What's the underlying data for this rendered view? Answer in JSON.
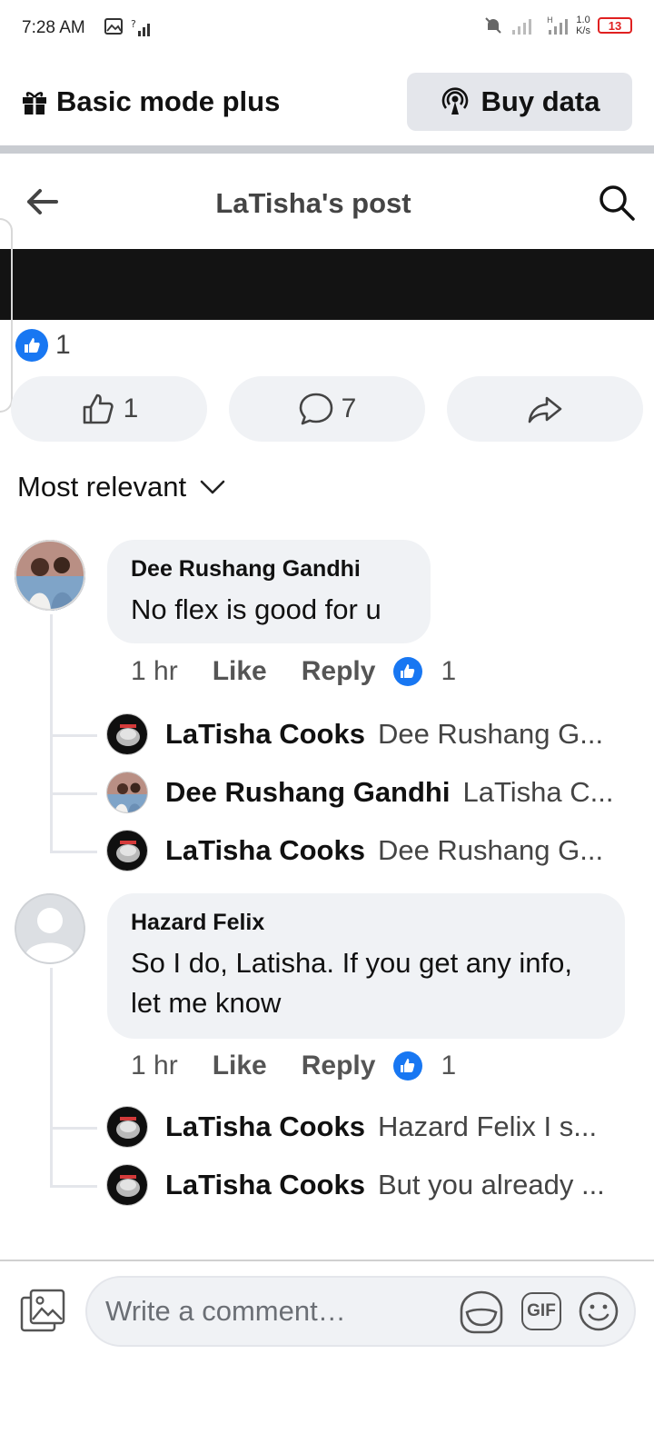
{
  "status_bar": {
    "time": "7:28 AM",
    "network_speed_value": "1.0",
    "network_speed_unit": "K/s",
    "battery_level": "13"
  },
  "mode_bar": {
    "title": "Basic mode plus",
    "buy_data_label": "Buy data"
  },
  "header": {
    "title": "LaTisha's post"
  },
  "reactions": {
    "like_count": "1"
  },
  "actions": {
    "like_count": "1",
    "comment_count": "7"
  },
  "sort": {
    "label": "Most relevant"
  },
  "comments": [
    {
      "author": "Dee Rushang Gandhi",
      "text": "No flex is good for u",
      "time": "1 hr",
      "like_label": "Like",
      "reply_label": "Reply",
      "reaction_count": "1",
      "replies": [
        {
          "author": "LaTisha Cooks",
          "text": "Dee Rushang G..."
        },
        {
          "author": "Dee Rushang Gandhi",
          "text": "LaTisha C..."
        },
        {
          "author": "LaTisha Cooks",
          "text": "Dee Rushang G..."
        }
      ]
    },
    {
      "author": "Hazard Felix",
      "text_line1": "So I do, Latisha. If you get any info,",
      "text_line2": "let me know",
      "time": "1 hr",
      "like_label": "Like",
      "reply_label": "Reply",
      "reaction_count": "1",
      "replies": [
        {
          "author": "LaTisha Cooks",
          "text": "Hazard Felix I s..."
        },
        {
          "author": "LaTisha Cooks",
          "text": "But you already ..."
        }
      ]
    }
  ],
  "composer": {
    "placeholder": "Write a comment…",
    "gif_label": "GIF"
  },
  "colors": {
    "accent": "#1877f2",
    "bubble": "#f0f2f5",
    "battery_low": "#e02020"
  }
}
